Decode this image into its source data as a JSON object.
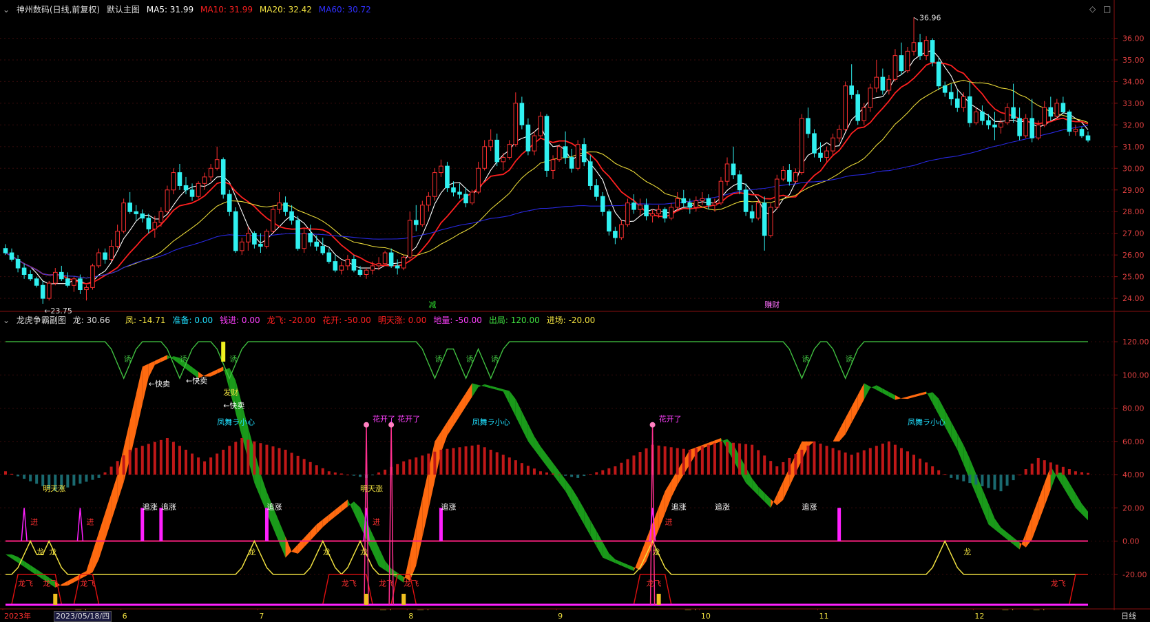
{
  "main_header": {
    "icon": "chevron-circle-icon",
    "stock": "神州数码(日线,前复权)",
    "mode": "默认主图",
    "ma5": {
      "label": "MA5: 31.99",
      "color": "#ffffff"
    },
    "ma10": {
      "label": "MA10: 31.99",
      "color": "#ff2020"
    },
    "ma20": {
      "label": "MA20: 32.42",
      "color": "#f0e040"
    },
    "ma60": {
      "label": "MA60: 30.72",
      "color": "#2020ff"
    }
  },
  "sub_header": {
    "name": "龙虎争霸副图",
    "items": [
      {
        "label": "龙: 30.66",
        "color": "#dddddd"
      },
      {
        "label": "凤: -14.71",
        "color": "#f0e040"
      },
      {
        "label": "准备: 0.00",
        "color": "#20e0ff"
      },
      {
        "label": "钱进: 0.00",
        "color": "#ff40ff"
      },
      {
        "label": "龙飞: -20.00",
        "color": "#ff2020"
      },
      {
        "label": "花开: -50.00",
        "color": "#ff2020"
      },
      {
        "label": "明天涨: 0.00",
        "color": "#ff2020"
      },
      {
        "label": "地量: -50.00",
        "color": "#ff40ff"
      },
      {
        "label": "出局: 120.00",
        "color": "#40e040"
      },
      {
        "label": "进场: -20.00",
        "color": "#f0e040"
      }
    ]
  },
  "icons": {
    "diamond": "diamond-icon",
    "square": "square-icon"
  },
  "bottom": {
    "period": "日线",
    "highlight_date": "2023/05/18/四",
    "month_labels": [
      "2023年",
      "6",
      "7",
      "8",
      "9",
      "10",
      "11",
      "12"
    ]
  },
  "chart_data": [
    {
      "type": "candlestick",
      "ylim": [
        23.4,
        37.0
      ],
      "y_ticks": [
        24.0,
        25.0,
        26.0,
        27.0,
        28.0,
        29.0,
        30.0,
        31.0,
        32.0,
        33.0,
        34.0,
        35.0,
        36.0
      ],
      "annotations": [
        {
          "text": "←23.75",
          "value": 23.75
        },
        {
          "text": "36.96",
          "value": 36.96
        }
      ],
      "marker_texts": [
        "减",
        "赚财"
      ],
      "series": [
        {
          "name": "MA5",
          "color": "#ffffff"
        },
        {
          "name": "MA10",
          "color": "#ff2020"
        },
        {
          "name": "MA20",
          "color": "#f0e040"
        },
        {
          "name": "MA60",
          "color": "#2020ff"
        }
      ],
      "candles": [
        [
          26.3,
          26.5,
          26.0,
          26.1
        ],
        [
          26.1,
          26.3,
          25.7,
          25.8
        ],
        [
          25.8,
          26.0,
          25.2,
          25.4
        ],
        [
          25.4,
          25.6,
          24.9,
          25.1
        ],
        [
          25.1,
          25.3,
          24.8,
          24.9
        ],
        [
          24.9,
          25.0,
          24.5,
          24.6
        ],
        [
          24.6,
          24.8,
          23.75,
          24.0
        ],
        [
          24.0,
          24.8,
          23.9,
          24.7
        ],
        [
          24.7,
          25.4,
          24.6,
          25.2
        ],
        [
          25.2,
          25.5,
          24.8,
          24.9
        ],
        [
          24.9,
          25.2,
          24.5,
          24.6
        ],
        [
          24.6,
          25.0,
          24.3,
          24.9
        ],
        [
          24.9,
          25.1,
          24.2,
          24.4
        ],
        [
          24.4,
          24.6,
          23.9,
          24.5
        ],
        [
          24.5,
          25.6,
          24.4,
          25.5
        ],
        [
          25.5,
          26.3,
          25.4,
          26.1
        ],
        [
          26.1,
          26.3,
          25.6,
          25.8
        ],
        [
          25.8,
          26.7,
          25.7,
          26.4
        ],
        [
          26.4,
          27.4,
          26.3,
          27.1
        ],
        [
          27.1,
          28.6,
          27.0,
          28.4
        ],
        [
          28.4,
          28.9,
          27.9,
          28.0
        ],
        [
          28.0,
          28.3,
          27.6,
          27.9
        ],
        [
          27.9,
          28.1,
          27.5,
          27.7
        ],
        [
          27.7,
          27.9,
          27.0,
          27.2
        ],
        [
          27.2,
          27.8,
          26.8,
          27.5
        ],
        [
          27.5,
          28.2,
          27.3,
          28.0
        ],
        [
          28.0,
          29.2,
          27.9,
          29.0
        ],
        [
          29.0,
          30.0,
          28.8,
          29.8
        ],
        [
          29.8,
          30.2,
          29.0,
          29.2
        ],
        [
          29.2,
          29.6,
          28.8,
          29.0
        ],
        [
          29.0,
          29.3,
          28.5,
          28.7
        ],
        [
          28.7,
          29.4,
          28.6,
          29.3
        ],
        [
          29.3,
          29.8,
          29.0,
          29.6
        ],
        [
          29.6,
          30.2,
          29.4,
          30.0
        ],
        [
          30.0,
          31.0,
          29.9,
          30.4
        ],
        [
          30.4,
          30.5,
          28.6,
          28.8
        ],
        [
          28.8,
          29.0,
          27.8,
          28.0
        ],
        [
          28.0,
          28.2,
          26.1,
          26.2
        ],
        [
          26.2,
          26.8,
          26.0,
          26.6
        ],
        [
          26.6,
          27.3,
          26.2,
          27.0
        ],
        [
          27.0,
          27.1,
          26.3,
          26.5
        ],
        [
          26.5,
          27.0,
          26.1,
          26.4
        ],
        [
          26.4,
          27.2,
          26.3,
          27.1
        ],
        [
          27.1,
          28.3,
          27.0,
          28.1
        ],
        [
          28.1,
          28.9,
          27.9,
          28.4
        ],
        [
          28.4,
          28.7,
          27.8,
          28.0
        ],
        [
          28.0,
          28.3,
          27.4,
          27.6
        ],
        [
          27.6,
          27.8,
          26.2,
          26.3
        ],
        [
          26.3,
          27.2,
          26.1,
          27.0
        ],
        [
          27.0,
          27.4,
          26.4,
          26.6
        ],
        [
          26.6,
          26.9,
          26.2,
          26.4
        ],
        [
          26.4,
          26.8,
          26.0,
          26.1
        ],
        [
          26.1,
          26.3,
          25.6,
          25.7
        ],
        [
          25.7,
          26.0,
          25.2,
          25.3
        ],
        [
          25.3,
          25.7,
          25.1,
          25.5
        ],
        [
          25.5,
          26.0,
          25.3,
          25.8
        ],
        [
          25.8,
          26.0,
          25.2,
          25.3
        ],
        [
          25.3,
          25.5,
          25.0,
          25.1
        ],
        [
          25.1,
          25.4,
          24.9,
          25.3
        ],
        [
          25.3,
          25.7,
          25.1,
          25.5
        ],
        [
          25.5,
          25.9,
          25.3,
          25.6
        ],
        [
          25.6,
          26.2,
          25.5,
          26.1
        ],
        [
          26.1,
          26.3,
          25.4,
          25.5
        ],
        [
          25.5,
          25.8,
          25.1,
          25.4
        ],
        [
          25.4,
          26.0,
          25.3,
          25.9
        ],
        [
          25.9,
          28.0,
          25.8,
          27.6
        ],
        [
          27.6,
          28.3,
          27.1,
          27.4
        ],
        [
          27.4,
          28.5,
          27.3,
          28.3
        ],
        [
          28.3,
          28.9,
          28.0,
          28.7
        ],
        [
          28.7,
          30.0,
          28.5,
          29.8
        ],
        [
          29.8,
          30.4,
          29.6,
          30.1
        ],
        [
          30.1,
          30.3,
          28.9,
          29.1
        ],
        [
          29.1,
          29.4,
          28.7,
          28.9
        ],
        [
          28.9,
          29.3,
          28.6,
          28.8
        ],
        [
          28.8,
          29.1,
          28.2,
          28.4
        ],
        [
          28.4,
          29.0,
          28.3,
          28.9
        ],
        [
          28.9,
          30.3,
          28.8,
          30.0
        ],
        [
          30.0,
          31.3,
          29.9,
          31.0
        ],
        [
          31.0,
          31.8,
          30.8,
          31.3
        ],
        [
          31.3,
          31.6,
          30.1,
          30.3
        ],
        [
          30.3,
          30.7,
          29.9,
          30.5
        ],
        [
          30.5,
          31.3,
          30.4,
          31.1
        ],
        [
          31.1,
          33.5,
          31.0,
          33.0
        ],
        [
          33.0,
          33.3,
          31.8,
          32.0
        ],
        [
          32.0,
          32.3,
          30.6,
          30.8
        ],
        [
          30.8,
          31.7,
          30.6,
          31.5
        ],
        [
          31.5,
          32.6,
          31.4,
          32.4
        ],
        [
          32.4,
          32.5,
          29.6,
          29.9
        ],
        [
          29.9,
          30.6,
          29.5,
          30.4
        ],
        [
          30.4,
          31.1,
          30.3,
          31.0
        ],
        [
          31.0,
          31.7,
          30.2,
          30.5
        ],
        [
          30.5,
          30.9,
          29.8,
          30.0
        ],
        [
          30.0,
          31.3,
          29.9,
          31.1
        ],
        [
          31.1,
          31.4,
          30.1,
          30.3
        ],
        [
          30.3,
          30.6,
          29.0,
          29.2
        ],
        [
          29.2,
          29.5,
          28.5,
          28.7
        ],
        [
          28.7,
          28.9,
          27.8,
          28.0
        ],
        [
          28.0,
          28.1,
          26.9,
          27.1
        ],
        [
          27.1,
          27.3,
          26.5,
          26.8
        ],
        [
          26.8,
          27.6,
          26.7,
          27.4
        ],
        [
          27.4,
          28.6,
          27.3,
          28.4
        ],
        [
          28.4,
          28.8,
          27.9,
          28.1
        ],
        [
          28.1,
          28.6,
          27.8,
          28.3
        ],
        [
          28.3,
          28.6,
          27.6,
          27.8
        ],
        [
          27.8,
          28.1,
          27.5,
          27.9
        ],
        [
          27.9,
          28.3,
          27.7,
          28.1
        ],
        [
          28.1,
          28.2,
          27.5,
          27.7
        ],
        [
          27.7,
          28.4,
          27.6,
          28.2
        ],
        [
          28.2,
          28.9,
          28.0,
          28.6
        ],
        [
          28.6,
          29.0,
          28.2,
          28.4
        ],
        [
          28.4,
          28.6,
          27.9,
          28.2
        ],
        [
          28.2,
          28.7,
          28.0,
          28.5
        ],
        [
          28.5,
          28.9,
          28.3,
          28.6
        ],
        [
          28.6,
          28.8,
          28.1,
          28.3
        ],
        [
          28.3,
          28.6,
          28.0,
          28.4
        ],
        [
          28.4,
          29.6,
          28.3,
          29.4
        ],
        [
          29.4,
          30.5,
          29.2,
          30.2
        ],
        [
          30.2,
          31.0,
          29.5,
          29.7
        ],
        [
          29.7,
          29.9,
          28.8,
          29.0
        ],
        [
          29.0,
          29.3,
          27.8,
          28.0
        ],
        [
          28.0,
          28.3,
          27.5,
          27.7
        ],
        [
          27.7,
          28.6,
          27.6,
          28.4
        ],
        [
          28.4,
          28.7,
          26.2,
          26.9
        ],
        [
          26.9,
          28.4,
          26.8,
          28.2
        ],
        [
          28.2,
          29.7,
          28.1,
          29.5
        ],
        [
          29.5,
          30.1,
          29.4,
          29.9
        ],
        [
          29.9,
          30.2,
          29.2,
          29.4
        ],
        [
          29.4,
          30.0,
          29.3,
          29.8
        ],
        [
          29.8,
          32.5,
          29.7,
          32.3
        ],
        [
          32.3,
          32.8,
          31.4,
          31.6
        ],
        [
          31.6,
          31.8,
          30.5,
          30.7
        ],
        [
          30.7,
          31.2,
          30.3,
          30.5
        ],
        [
          30.5,
          31.0,
          30.3,
          30.8
        ],
        [
          30.8,
          31.6,
          30.6,
          31.4
        ],
        [
          31.4,
          32.0,
          31.2,
          31.8
        ],
        [
          31.8,
          34.0,
          31.7,
          33.8
        ],
        [
          33.8,
          34.8,
          33.2,
          33.4
        ],
        [
          33.4,
          33.6,
          32.0,
          32.2
        ],
        [
          32.2,
          33.0,
          32.0,
          32.8
        ],
        [
          32.8,
          33.9,
          32.6,
          33.7
        ],
        [
          33.7,
          35.0,
          33.5,
          34.2
        ],
        [
          34.2,
          34.6,
          33.4,
          33.6
        ],
        [
          33.6,
          34.3,
          33.4,
          34.1
        ],
        [
          34.1,
          35.5,
          34.0,
          35.2
        ],
        [
          35.2,
          35.8,
          34.3,
          34.5
        ],
        [
          34.5,
          35.6,
          34.4,
          35.4
        ],
        [
          35.4,
          36.96,
          35.2,
          35.8
        ],
        [
          35.8,
          36.2,
          35.0,
          35.2
        ],
        [
          35.2,
          36.1,
          35.0,
          35.9
        ],
        [
          35.9,
          36.0,
          34.7,
          34.9
        ],
        [
          34.9,
          35.1,
          33.6,
          33.8
        ],
        [
          33.8,
          34.0,
          33.3,
          33.5
        ],
        [
          33.5,
          33.9,
          32.9,
          33.2
        ],
        [
          33.2,
          33.6,
          32.6,
          32.8
        ],
        [
          32.8,
          33.5,
          32.6,
          33.3
        ],
        [
          33.3,
          34.0,
          31.9,
          32.1
        ],
        [
          32.1,
          32.8,
          32.0,
          32.6
        ],
        [
          32.6,
          32.9,
          32.0,
          32.2
        ],
        [
          32.2,
          32.5,
          31.8,
          32.0
        ],
        [
          32.0,
          32.6,
          31.3,
          31.9
        ],
        [
          31.9,
          32.3,
          31.6,
          32.1
        ],
        [
          32.1,
          33.0,
          32.0,
          32.8
        ],
        [
          32.8,
          33.9,
          32.1,
          32.3
        ],
        [
          32.3,
          32.8,
          31.3,
          31.5
        ],
        [
          31.5,
          32.5,
          31.4,
          32.3
        ],
        [
          32.3,
          33.2,
          31.2,
          31.4
        ],
        [
          31.4,
          32.2,
          31.3,
          32.0
        ],
        [
          32.0,
          33.1,
          31.9,
          32.8
        ],
        [
          32.8,
          33.3,
          32.2,
          32.4
        ],
        [
          32.4,
          33.2,
          32.3,
          33.0
        ],
        [
          33.0,
          33.3,
          32.5,
          32.6
        ],
        [
          32.6,
          32.7,
          31.5,
          31.7
        ],
        [
          31.7,
          32.0,
          31.5,
          31.8
        ],
        [
          31.8,
          31.9,
          31.4,
          31.5
        ],
        [
          31.5,
          31.7,
          31.2,
          31.3
        ]
      ]
    },
    {
      "type": "indicator",
      "ylim": [
        -40,
        130
      ],
      "y_ticks": [
        120.0,
        100.0,
        80.0,
        60.0,
        40.0,
        20.0,
        0.0,
        -20.0
      ],
      "text_labels": [
        "←快卖",
        "发财",
        "←快卖",
        "凤舞ラ小心",
        "明天涨",
        "进",
        "追涨",
        "花开了",
        "龙飞",
        "↑CCI买点",
        "龙",
        "诱"
      ]
    }
  ]
}
